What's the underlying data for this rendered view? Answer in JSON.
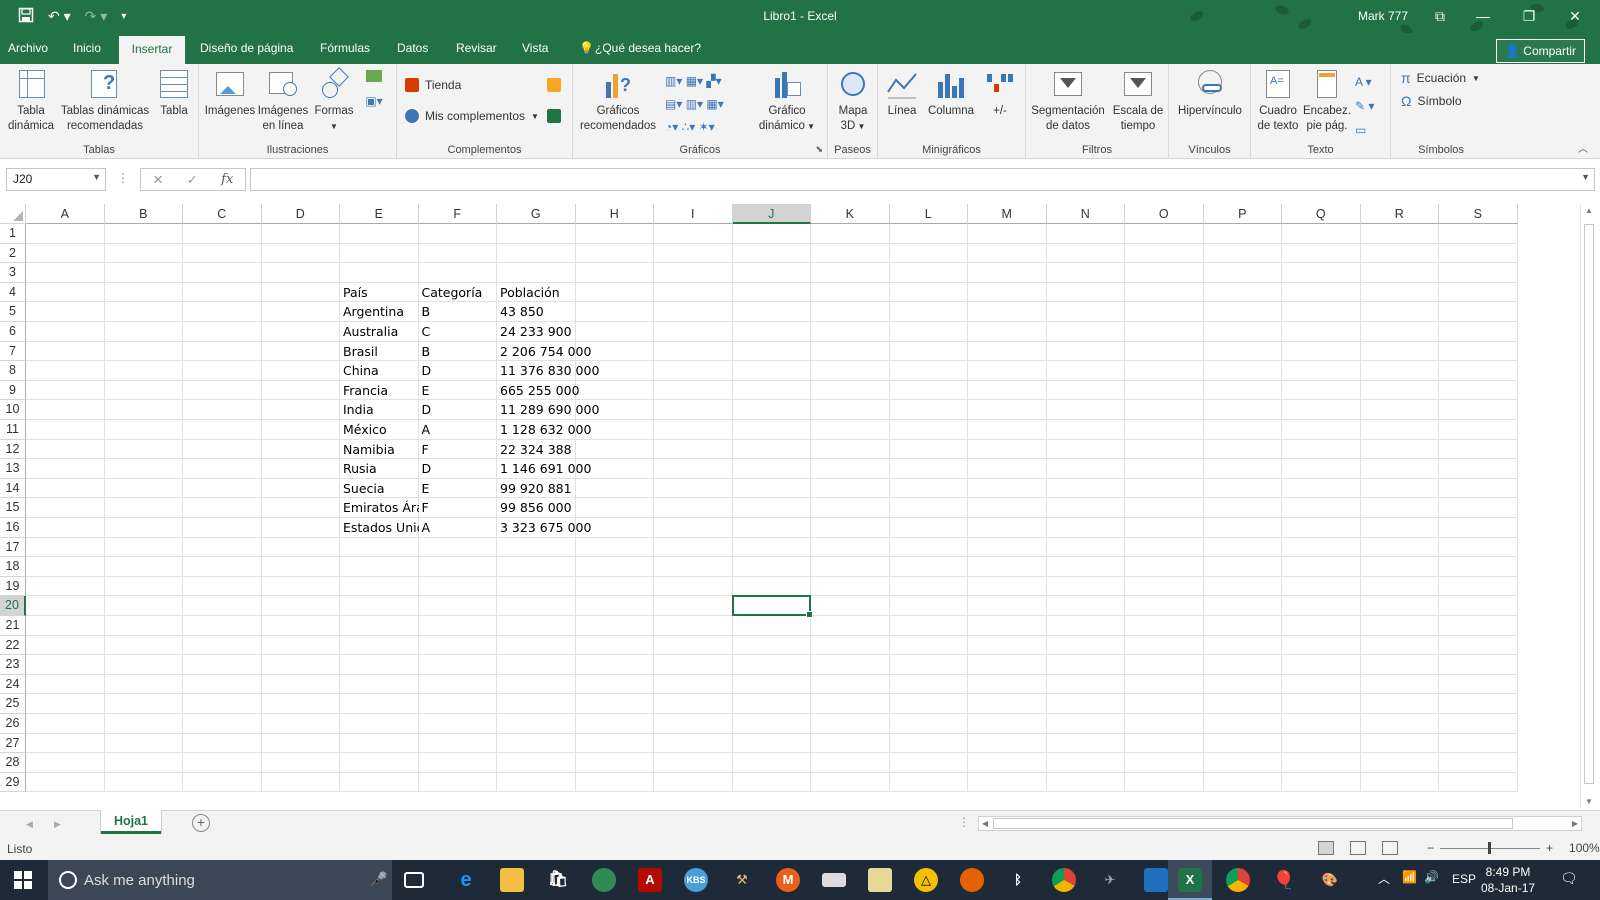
{
  "window": {
    "title": "Libro1  -  Excel",
    "user": "Mark 777",
    "share_label": "Compartir"
  },
  "tabs": [
    "Archivo",
    "Inicio",
    "Insertar",
    "Diseño de página",
    "Fórmulas",
    "Datos",
    "Revisar",
    "Vista",
    "¿Qué desea hacer?"
  ],
  "active_tab": "Insertar",
  "ribbon": {
    "groups": {
      "tablas": "Tablas",
      "ilustraciones": "Ilustraciones",
      "complementos": "Complementos",
      "graficos": "Gráficos",
      "paseos": "Paseos",
      "minigraficos": "Minigráficos",
      "filtros": "Filtros",
      "vinculos": "Vínculos",
      "texto": "Texto",
      "simbolos": "Símbolos"
    },
    "buttons": {
      "tabla_dinamica": [
        "Tabla",
        "dinámica"
      ],
      "tablas_recomendadas": [
        "Tablas dinámicas",
        "recomendadas"
      ],
      "tabla": "Tabla",
      "imagenes": "Imágenes",
      "imagenes_linea": [
        "Imágenes",
        "en línea"
      ],
      "formas": "Formas",
      "tienda": "Tienda",
      "mis_complementos": "Mis complementos",
      "graficos_recomendados": [
        "Gráficos",
        "recomendados"
      ],
      "grafico_dinamico": [
        "Gráfico",
        "dinámico"
      ],
      "mapa_3d": [
        "Mapa",
        "3D"
      ],
      "linea": "Línea",
      "columna": "Columna",
      "ganancia": "+/-",
      "segmentacion": [
        "Segmentación",
        "de datos"
      ],
      "escala_tiempo": [
        "Escala de",
        "tiempo"
      ],
      "hipervinculo": "Hipervínculo",
      "cuadro_texto": [
        "Cuadro",
        "de texto"
      ],
      "encabez": [
        "Encabez.",
        "pie pág."
      ],
      "ecuacion": "Ecuación",
      "simbolo": "Símbolo"
    }
  },
  "formula_bar": {
    "name_box": "J20",
    "fx": "fx",
    "value": ""
  },
  "columns": [
    "A",
    "B",
    "C",
    "D",
    "E",
    "F",
    "G",
    "H",
    "I",
    "J",
    "K",
    "L",
    "M",
    "N",
    "O",
    "P",
    "Q",
    "R",
    "S"
  ],
  "selected_column": "J",
  "rows": [
    "1",
    "2",
    "3",
    "4",
    "5",
    "6",
    "7",
    "8",
    "9",
    "10",
    "11",
    "12",
    "13",
    "14",
    "15",
    "16",
    "17",
    "18",
    "19",
    "20",
    "21",
    "22",
    "23",
    "24",
    "25",
    "26",
    "27",
    "28",
    "29"
  ],
  "selected_row": "20",
  "table": {
    "header": [
      "País",
      "Categoría",
      "Población"
    ],
    "rows": [
      [
        "Argentina",
        "B",
        "43 850"
      ],
      [
        "Australia",
        "C",
        "24 233 900"
      ],
      [
        "Brasil",
        "B",
        "2 206 754 000"
      ],
      [
        "China",
        "D",
        "11 376 830 000"
      ],
      [
        "Francia",
        "E",
        "665 255 000"
      ],
      [
        "India",
        "D",
        "11 289 690 000"
      ],
      [
        "México",
        "A",
        "1 128 632 000"
      ],
      [
        "Namibia",
        "F",
        "22 324 388"
      ],
      [
        "Rusia",
        "D",
        "1 146 691 000"
      ],
      [
        "Suecia",
        "E",
        "99 920 881"
      ],
      [
        "Emiratos Ára",
        "F",
        "99 856 000"
      ],
      [
        "Estados Unic",
        "A",
        "3 323 675 000"
      ]
    ]
  },
  "sheet": {
    "tab": "Hoja1",
    "add": "+"
  },
  "status": {
    "text": "Listo",
    "zoom": "100%"
  },
  "taskbar": {
    "search_placeholder": "Ask me anything",
    "lang": "ESP",
    "time": "8:49 PM",
    "date": "08-Jan-17"
  },
  "colors": {
    "excel_green": "#217346",
    "taskbar": "#1e2a38"
  }
}
